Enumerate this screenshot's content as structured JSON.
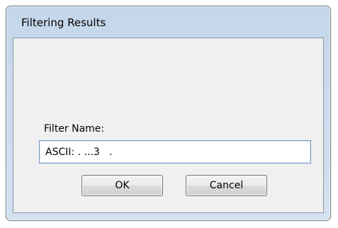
{
  "window": {
    "title": "Filtering Results"
  },
  "form": {
    "filter_name_label": "Filter Name:",
    "filter_name_value": "ASCII: . ...3   ."
  },
  "buttons": {
    "ok_label": "OK",
    "cancel_label": "Cancel"
  }
}
